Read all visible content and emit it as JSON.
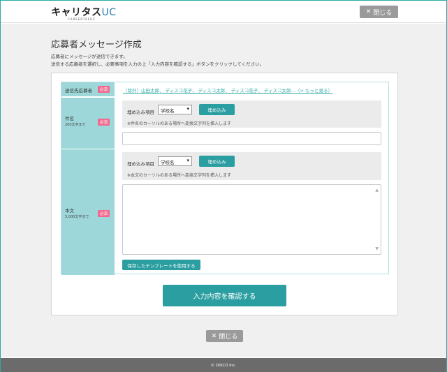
{
  "header": {
    "logo_main": "キャリタス",
    "logo_uc": "UC",
    "logo_sub": "CAREERTASUC",
    "close_label": "閉じる"
  },
  "page": {
    "title": "応募者メッセージ作成",
    "desc_line1": "応募者にメッセージが送信できます。",
    "desc_line2": "送信する応募者を選択し、必要事項を入力の上「入力内容を確認する」ボタンをクリックしてください。"
  },
  "form": {
    "recipients_label": "送信先応募者",
    "required_label": "必須",
    "recipients_text": "（除外）山田太郎、 ディスコ花子、 ディスコ太郎、 ディスコ花子、 ディスコ太郎…（> もっと見る）",
    "subject_label": "件名",
    "subject_limit": "200文字まで",
    "body_label": "本文",
    "body_limit": "5,000文字まで",
    "embed_label": "埋め込み項目",
    "embed_select_value": "学校名",
    "embed_button": "埋め込み",
    "subject_note": "※件名のカーソルのある場所へ変換文字列を挿入します",
    "body_note": "※本文のカーソルのある場所へ変換文字列を挿入します",
    "subject_value": "",
    "body_value": "",
    "template_button": "保存したテンプレートを使用する"
  },
  "actions": {
    "confirm_label": "入力内容を確認する",
    "close_label": "閉じる"
  },
  "footer": {
    "copyright": "© DISCO Inc."
  },
  "colors": {
    "accent": "#2a9ea0",
    "label_bg": "#9dd7d9",
    "required": "#f06a8f"
  }
}
